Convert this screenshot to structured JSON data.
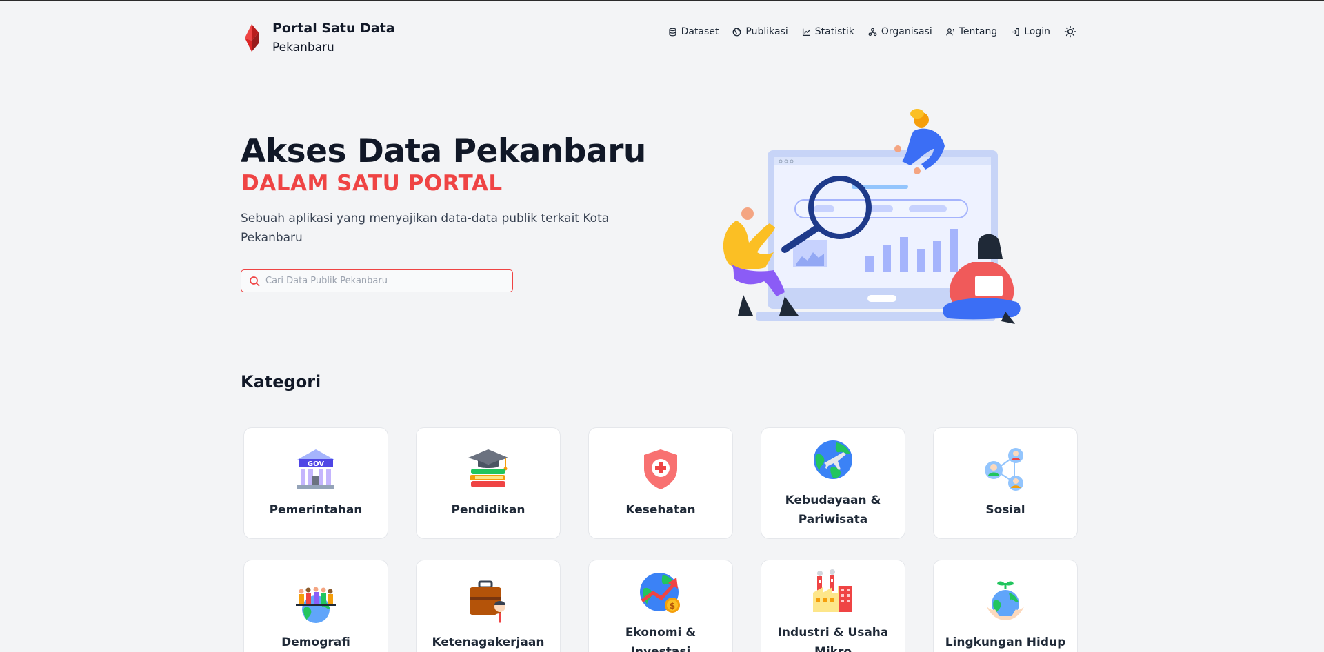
{
  "brand": {
    "title": "Portal Satu Data",
    "subtitle": "Pekanbaru",
    "accent_color": "#ef4444",
    "logo_color": "#dc2626"
  },
  "nav": {
    "items": [
      {
        "label": "Dataset",
        "icon": "database-icon"
      },
      {
        "label": "Publikasi",
        "icon": "globe-icon"
      },
      {
        "label": "Statistik",
        "icon": "chart-line-icon"
      },
      {
        "label": "Organisasi",
        "icon": "organization-icon"
      },
      {
        "label": "Tentang",
        "icon": "user-info-icon"
      },
      {
        "label": "Login",
        "icon": "login-icon"
      }
    ],
    "theme_toggle_icon": "sun-icon"
  },
  "hero": {
    "title": "Akses Data Pekanbaru",
    "subtitle": "DALAM SATU PORTAL",
    "description": "Sebuah aplikasi yang menyajikan data-data publik terkait Kota Pekanbaru",
    "search_placeholder": "Cari Data Publik Pekanbaru",
    "search_value": ""
  },
  "kategori": {
    "title": "Kategori",
    "items": [
      {
        "label": "Pemerintahan",
        "icon": "government-building-icon"
      },
      {
        "label": "Pendidikan",
        "icon": "graduation-books-icon"
      },
      {
        "label": "Kesehatan",
        "icon": "health-shield-icon"
      },
      {
        "label": "Kebudayaan & Pariwisata",
        "icon": "globe-plane-icon"
      },
      {
        "label": "Sosial",
        "icon": "social-network-icon"
      },
      {
        "label": "Demografi",
        "icon": "population-globe-icon"
      },
      {
        "label": "Ketenagakerjaan",
        "icon": "briefcase-worker-icon"
      },
      {
        "label": "Ekonomi & Investasi",
        "icon": "economy-growth-icon"
      },
      {
        "label": "Industri & Usaha Mikro",
        "icon": "factory-icon"
      },
      {
        "label": "Lingkungan Hidup",
        "icon": "environment-globe-icon"
      }
    ]
  }
}
